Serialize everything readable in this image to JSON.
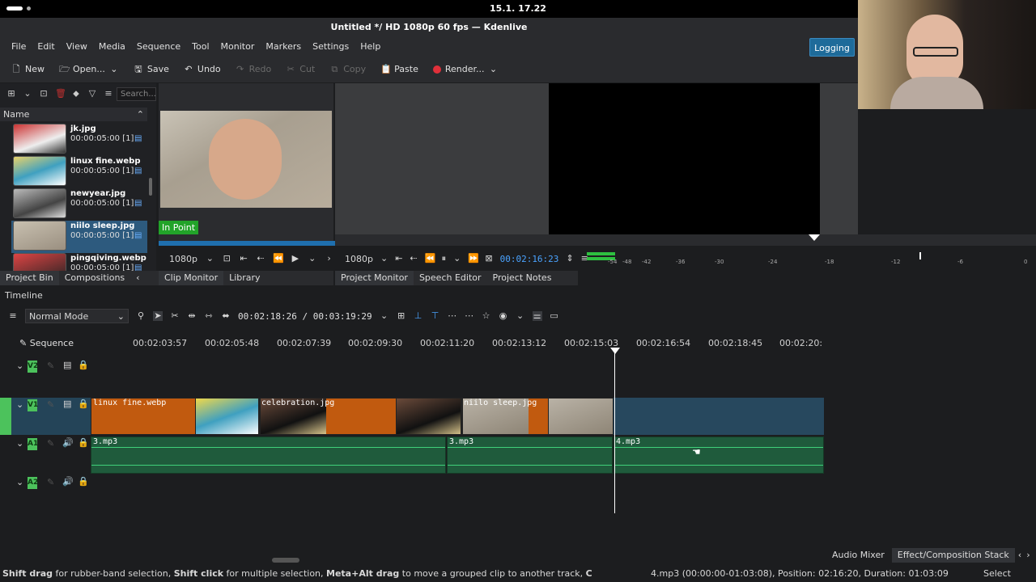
{
  "system": {
    "clock": "15.1. 17.22"
  },
  "window": {
    "title": "Untitled */ HD 1080p 60 fps — Kdenlive"
  },
  "menu": [
    "File",
    "Edit",
    "View",
    "Media",
    "Sequence",
    "Tool",
    "Monitor",
    "Markers",
    "Settings",
    "Help"
  ],
  "toolbar": {
    "new": "New",
    "open": "Open...",
    "save": "Save",
    "undo": "Undo",
    "redo": "Redo",
    "cut": "Cut",
    "copy": "Copy",
    "paste": "Paste",
    "render": "Render..."
  },
  "logging": "Logging",
  "bin": {
    "search_placeholder": "Search...",
    "header": "Name",
    "items": [
      {
        "name": "jk.jpg",
        "duration": "00:00:05:00 [1]"
      },
      {
        "name": "linux fine.webp",
        "duration": "00:00:05:00 [1]"
      },
      {
        "name": "newyear.jpg",
        "duration": "00:00:05:00 [1]"
      },
      {
        "name": "niilo sleep.jpg",
        "duration": "00:00:05:00 [1]"
      },
      {
        "name": "pingqiving.webp",
        "duration": "00:00:05:00 [1]"
      }
    ],
    "tabs": [
      "Project Bin",
      "Compositions"
    ]
  },
  "clip_monitor": {
    "in_point": "In Point",
    "resolution": "1080p",
    "tabs": [
      "Clip Monitor",
      "Library"
    ]
  },
  "project_monitor": {
    "resolution": "1080p",
    "timecode": "00:02:16:23",
    "tabs": [
      "Project Monitor",
      "Speech Editor",
      "Project Notes"
    ],
    "meter_labels": [
      "-54",
      "-48",
      "-42",
      "-36",
      "-30",
      "-24",
      "-18",
      "-12",
      "-6",
      "0"
    ]
  },
  "timeline": {
    "header": "Timeline",
    "mode": "Normal Mode",
    "timecode": "00:02:18:26 / 00:03:19:29",
    "sequence": "Sequence",
    "ruler": [
      "00:02:03:57",
      "00:02:05:48",
      "00:02:07:39",
      "00:02:09:30",
      "00:02:11:20",
      "00:02:13:12",
      "00:02:15:03",
      "00:02:16:54",
      "00:02:18:45",
      "00:02:20:"
    ],
    "tracks": [
      "V2",
      "V1",
      "A1",
      "A2"
    ],
    "video_clips": [
      "linux fine.webp",
      "celebration.jpg",
      "niilo sleep.jpg"
    ],
    "audio_clips": [
      "3.mp3",
      "3.mp3",
      "4.mp3"
    ]
  },
  "right_tabs": [
    "Audio Mixer",
    "Effect/Composition Stack"
  ],
  "status": {
    "hint_b1": "Shift drag",
    "hint_t1": " for rubber-band selection, ",
    "hint_b2": "Shift click",
    "hint_t2": " for multiple selection, ",
    "hint_b3": "Meta+Alt drag",
    "hint_t3": " to move a grouped clip to another track, ",
    "hint_b4": "C",
    "clip_info": "4.mp3 (00:00:00-01:03:08), Position: 02:16:20, Duration: 01:03:09",
    "tool": "Select"
  },
  "colors": {
    "accent": "#2d7fd0",
    "track_green": "#4cc25c",
    "video_clip": "#c15a0f",
    "audio_clip": "#1f5b3c"
  }
}
